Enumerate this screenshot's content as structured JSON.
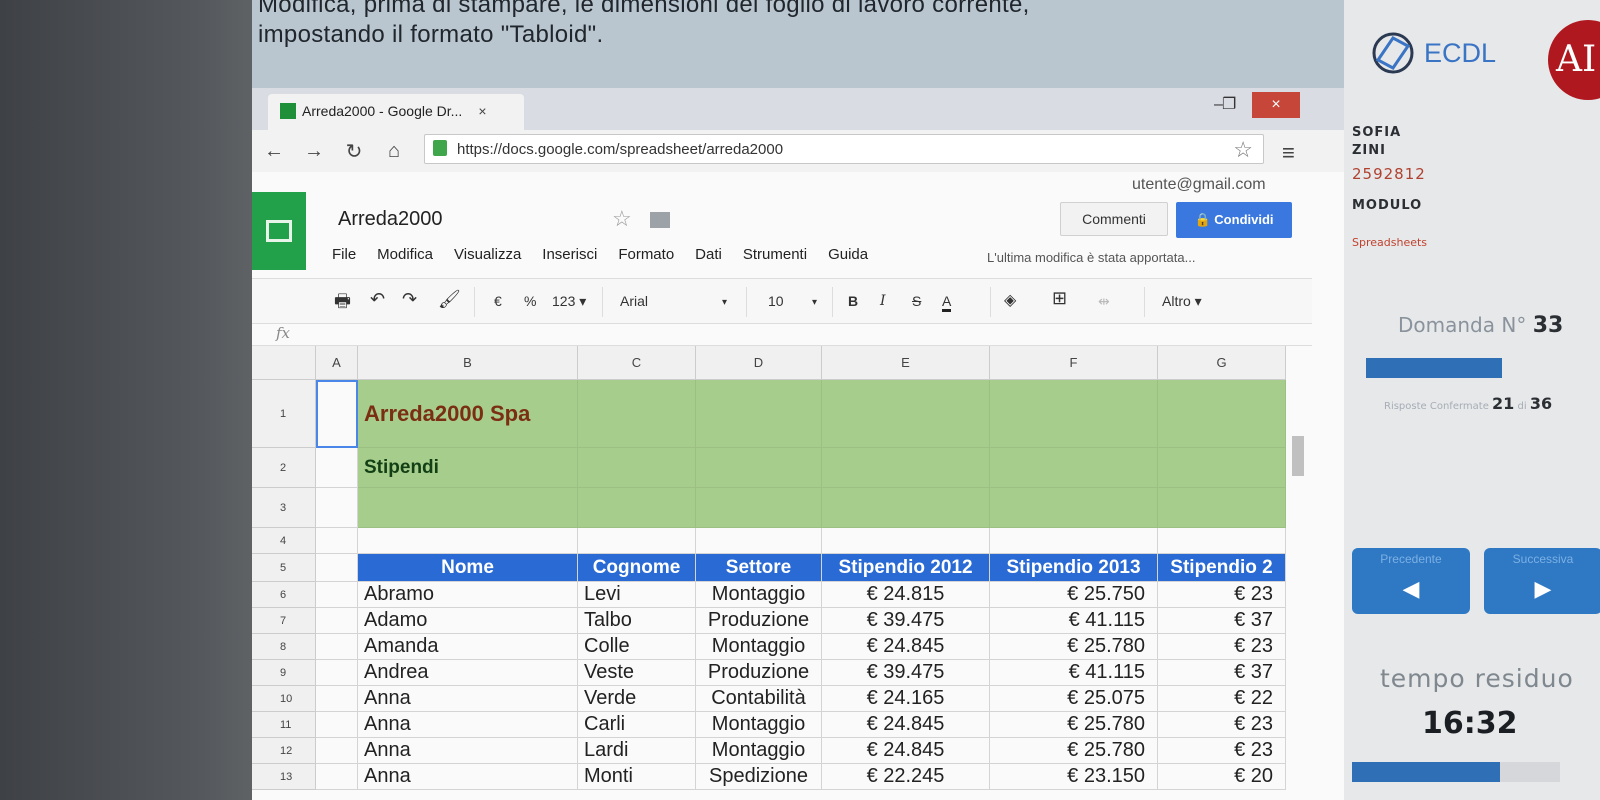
{
  "exam": {
    "question_line1": "Modifica, prima di stampare, le dimensioni del foglio di lavoro corrente,",
    "question_line2": "impostando il formato \"Tabloid\"."
  },
  "right_panel": {
    "brand": "ECDL",
    "aica_logo": "AI",
    "first_name": "SOFIA",
    "last_name": "ZINI",
    "candidate_id": "2592812",
    "modulo_label": "MODULO",
    "module_name": "Spreadsheets",
    "domanda_label": "Domanda N°",
    "domanda_number": "33",
    "risposte_label": "Risposte Confermate",
    "risposte_count": "21",
    "risposte_of": "di",
    "risposte_total": "36",
    "prev_label": "Precedente",
    "next_label": "Successiva",
    "prev_arrow": "◀",
    "next_arrow": "▶",
    "tempo_label": "tempo residuo",
    "time_left": "16:32"
  },
  "browser": {
    "tab_title": "Arreda2000 - Google Dr...",
    "tab_close": "×",
    "url": "https://docs.google.com/spreadsheet/arreda2000",
    "close": "×",
    "minimize": "‒",
    "restore": "❐"
  },
  "sheets": {
    "user": "utente@gmail.com",
    "title": "Arreda2000",
    "comments_label": "Commenti",
    "share_label": "Condividi",
    "menu": [
      "File",
      "Modifica",
      "Visualizza",
      "Inserisci",
      "Formato",
      "Dati",
      "Strumenti",
      "Guida"
    ],
    "last_edit": "L'ultima modifica è stata apportata...",
    "toolbar": {
      "currency": "€",
      "percent": "%",
      "number_format": "123 ▾",
      "font": "Arial",
      "font_size": "10",
      "bold": "B",
      "italic": "I",
      "strike": "S",
      "text_color": "A",
      "more": "Altro ▾"
    },
    "fx": "fx",
    "columns": [
      "A",
      "B",
      "C",
      "D",
      "E",
      "F",
      "G"
    ],
    "rows": [
      "1",
      "2",
      "3",
      "4",
      "5",
      "6",
      "7",
      "8",
      "9",
      "10",
      "11",
      "12",
      "13"
    ],
    "b1": "Arreda2000 Spa",
    "b2": "Stipendi",
    "headers": [
      "Nome",
      "Cognome",
      "Settore",
      "Stipendio 2012",
      "Stipendio 2013",
      "Stipendio 2"
    ],
    "data": [
      [
        "Abramo",
        "Levi",
        "Montaggio",
        "€ 24.815",
        "€ 25.750",
        "€ 23"
      ],
      [
        "Adamo",
        "Talbo",
        "Produzione",
        "€ 39.475",
        "€ 41.115",
        "€ 37"
      ],
      [
        "Amanda",
        "Colle",
        "Montaggio",
        "€ 24.845",
        "€ 25.780",
        "€ 23"
      ],
      [
        "Andrea",
        "Veste",
        "Produzione",
        "€ 39.475",
        "€ 41.115",
        "€ 37"
      ],
      [
        "Anna",
        "Verde",
        "Contabilità",
        "€ 24.165",
        "€ 25.075",
        "€ 22"
      ],
      [
        "Anna",
        "Carli",
        "Montaggio",
        "€ 24.845",
        "€ 25.780",
        "€ 23"
      ],
      [
        "Anna",
        "Lardi",
        "Montaggio",
        "€ 24.845",
        "€ 25.780",
        "€ 23"
      ],
      [
        "Anna",
        "Monti",
        "Spedizione",
        "€ 22.245",
        "€ 23.150",
        "€ 20"
      ]
    ]
  }
}
